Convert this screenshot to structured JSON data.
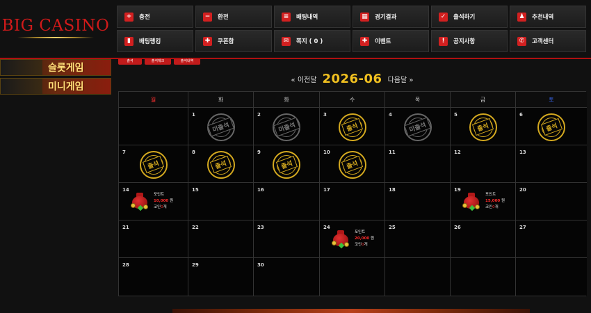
{
  "logo": {
    "text": "BIG CASINO"
  },
  "menu": [
    {
      "label": "충전",
      "icon": "plus-icon",
      "glyph": "+"
    },
    {
      "label": "환전",
      "icon": "minus-icon",
      "glyph": "−"
    },
    {
      "label": "배팅내역",
      "icon": "list-icon",
      "glyph": "≡"
    },
    {
      "label": "경기결과",
      "icon": "calendar-icon",
      "glyph": "▦"
    },
    {
      "label": "출석하기",
      "icon": "check-calendar-icon",
      "glyph": "✓"
    },
    {
      "label": "추천내역",
      "icon": "user-add-icon",
      "glyph": "♟"
    },
    {
      "label": "배팅랭킹",
      "icon": "ranking-icon",
      "glyph": "▮"
    },
    {
      "label": "쿠폰함",
      "icon": "gift-icon",
      "glyph": "✚"
    },
    {
      "label": "쪽지 ( 0 )",
      "icon": "mail-icon",
      "glyph": "✉"
    },
    {
      "label": "이벤트",
      "icon": "event-gift-icon",
      "glyph": "✚"
    },
    {
      "label": "공지사항",
      "icon": "notice-icon",
      "glyph": "!"
    },
    {
      "label": "고객센터",
      "icon": "phone-icon",
      "glyph": "✆"
    }
  ],
  "side_banners": [
    "슬롯게임",
    "미니게임"
  ],
  "tabs": [
    "출석",
    "출석체크",
    "출석내역"
  ],
  "calendar": {
    "prev_label": "« 이전달",
    "next_label": "다음달 »",
    "month": "2026-06",
    "weekdays": [
      {
        "label": "월",
        "color": "#ff3030"
      },
      {
        "label": "화",
        "color": "#cccccc"
      },
      {
        "label": "화",
        "color": "#cccccc"
      },
      {
        "label": "수",
        "color": "#cccccc"
      },
      {
        "label": "목",
        "color": "#cccccc"
      },
      {
        "label": "금",
        "color": "#cccccc"
      },
      {
        "label": "토",
        "color": "#3a6cff"
      }
    ],
    "stamp_present": "출석",
    "stamp_absent": "미출석",
    "weeks": [
      [
        null,
        {
          "day": "1",
          "status": "absent"
        },
        {
          "day": "2",
          "status": "absent"
        },
        {
          "day": "3",
          "status": "present"
        },
        {
          "day": "4",
          "status": "absent"
        },
        {
          "day": "5",
          "status": "present"
        },
        {
          "day": "6",
          "status": "present"
        }
      ],
      [
        {
          "day": "7",
          "status": "present"
        },
        {
          "day": "8",
          "status": "present"
        },
        {
          "day": "9",
          "status": "present"
        },
        {
          "day": "10",
          "status": "present"
        },
        {
          "day": "11"
        },
        {
          "day": "12"
        },
        {
          "day": "13"
        }
      ],
      [
        {
          "day": "14",
          "reward": {
            "title": "포인트",
            "amount": "10,000",
            "unit": "원",
            "coin_label": "코인",
            "coin_count": "0",
            "coin_unit": "개"
          }
        },
        {
          "day": "15"
        },
        {
          "day": "16"
        },
        {
          "day": "17"
        },
        {
          "day": "18"
        },
        {
          "day": "19",
          "reward": {
            "title": "포인트",
            "amount": "15,000",
            "unit": "원",
            "coin_label": "코인",
            "coin_count": "0",
            "coin_unit": "개"
          }
        },
        {
          "day": "20"
        }
      ],
      [
        {
          "day": "21"
        },
        {
          "day": "22"
        },
        {
          "day": "23"
        },
        {
          "day": "24",
          "reward": {
            "title": "포인트",
            "amount": "20,000",
            "unit": "원",
            "coin_label": "코인",
            "coin_count": "0",
            "coin_unit": "개"
          }
        },
        {
          "day": "25"
        },
        {
          "day": "26"
        },
        {
          "day": "27"
        }
      ],
      [
        {
          "day": "28"
        },
        {
          "day": "29"
        },
        {
          "day": "30"
        },
        null,
        null,
        null,
        null
      ]
    ]
  },
  "colors": {
    "accent": "#d22020",
    "gold": "#f0c020",
    "stamp_gold": "#d4a91f",
    "stamp_gray": "#666666"
  }
}
